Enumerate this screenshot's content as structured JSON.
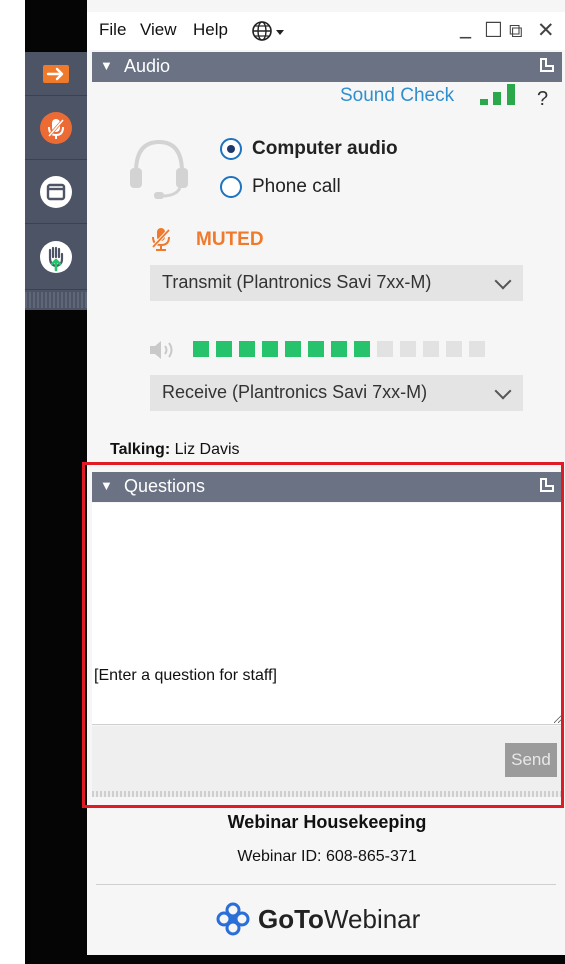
{
  "menu": {
    "file": "File",
    "view": "View",
    "help": "Help"
  },
  "window_controls": {
    "minimize": "_",
    "maximize": "☐",
    "restore": "⧉",
    "close": "✕"
  },
  "audio": {
    "title": "Audio",
    "sound_check": "Sound Check",
    "help": "?",
    "options": [
      {
        "label": "Computer audio",
        "selected": true
      },
      {
        "label": "Phone call",
        "selected": false
      }
    ],
    "mute_status": "MUTED",
    "transmit_device": "Transmit (Plantronics Savi 7xx-M)",
    "receive_device": "Receive (Plantronics Savi 7xx-M)",
    "speaker_level": {
      "lit_segments": 8,
      "total_segments": 13
    },
    "signal_strength": {
      "bars_lit": 3,
      "bars_total": 3
    }
  },
  "talking": {
    "label": "Talking:",
    "name": "Liz Davis"
  },
  "questions": {
    "title": "Questions",
    "input_placeholder": "[Enter a question for staff]",
    "send_label": "Send"
  },
  "footer": {
    "webinar_title": "Webinar Housekeeping",
    "webinar_id": "Webinar ID: 608-865-371",
    "brand_bold": "GoTo",
    "brand_regular": "Webinar"
  },
  "colors": {
    "toolbar_bg": "#4d5465",
    "header_bg": "#6a7284",
    "accent_orange": "#f07a2c",
    "link_blue": "#2f8fcf",
    "meter_green": "#27c26c",
    "meter_off": "#e2e2e2",
    "highlight_red": "#e01b24"
  }
}
